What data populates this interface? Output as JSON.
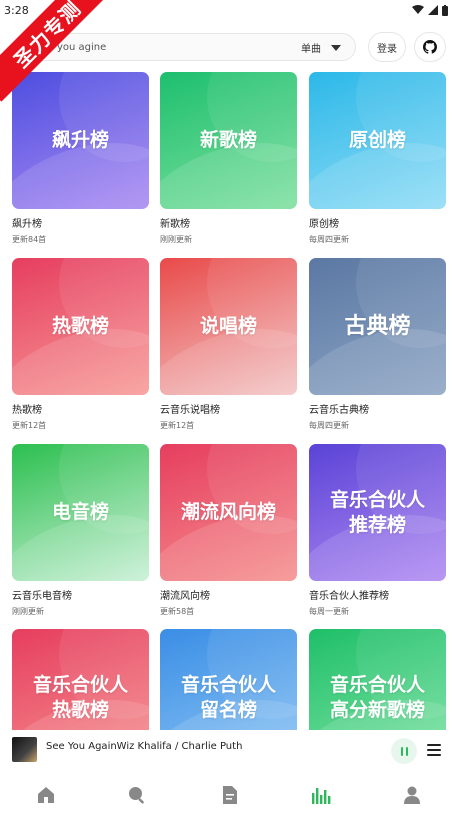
{
  "status": {
    "time": "3:28"
  },
  "ribbon": {
    "label": "圣力专测"
  },
  "search": {
    "value": "you agine",
    "type_label": "单曲"
  },
  "header": {
    "login_label": "登录"
  },
  "playlists": [
    {
      "cover_text": "飙升榜",
      "title": "飙升榜",
      "subtitle": "更新84首",
      "gradient": [
        "#4d4ee0",
        "#a98af2"
      ]
    },
    {
      "cover_text": "新歌榜",
      "title": "新歌榜",
      "subtitle": "刚刚更新",
      "gradient": [
        "#1dbf6e",
        "#7ee09f"
      ]
    },
    {
      "cover_text": "原创榜",
      "title": "原创榜",
      "subtitle": "每周四更新",
      "gradient": [
        "#2cb8e8",
        "#8fdcf6"
      ]
    },
    {
      "cover_text": "热歌榜",
      "title": "热歌榜",
      "subtitle": "更新12首",
      "gradient": [
        "#e63e5f",
        "#f79a97"
      ]
    },
    {
      "cover_text": "说唱榜",
      "title": "云音乐说唱榜",
      "subtitle": "更新12首",
      "gradient": [
        "#e94a4a",
        "#f3c6c6"
      ]
    },
    {
      "cover_text": "古典榜",
      "title": "云音乐古典榜",
      "subtitle": "每周四更新",
      "gradient": [
        "#5b78a3",
        "#8ba4c3"
      ]
    },
    {
      "cover_text": "电音榜",
      "title": "云音乐电音榜",
      "subtitle": "刚刚更新",
      "gradient": [
        "#2cbf4f",
        "#c8f0d5"
      ]
    },
    {
      "cover_text": "潮流风向榜",
      "title": "潮流风向榜",
      "subtitle": "更新58首",
      "gradient": [
        "#e63e5f",
        "#f58f8e"
      ]
    },
    {
      "cover_text": "音乐合伙人推荐榜",
      "title": "音乐合伙人推荐榜",
      "subtitle": "每周一更新",
      "gradient": [
        "#5a43d6",
        "#b08af2"
      ]
    },
    {
      "cover_text": "音乐合伙人热歌榜",
      "title": "",
      "subtitle": "",
      "gradient": [
        "#e63e5f",
        "#f5908e"
      ]
    },
    {
      "cover_text": "音乐合伙人留名榜",
      "title": "",
      "subtitle": "",
      "gradient": [
        "#3a8ee6",
        "#8cc4f3"
      ]
    },
    {
      "cover_text": "音乐合伙人高分新歌榜",
      "title": "",
      "subtitle": "",
      "gradient": [
        "#1fbf6a",
        "#7de3a2"
      ]
    }
  ],
  "player": {
    "song_text": "See You AgainWiz Khalifa / Charlie Puth"
  },
  "tabs": [
    {
      "icon": "home-icon",
      "active": false
    },
    {
      "icon": "search-icon",
      "active": false
    },
    {
      "icon": "document-icon",
      "active": false
    },
    {
      "icon": "chart-icon",
      "active": true
    },
    {
      "icon": "user-icon",
      "active": false
    }
  ],
  "colors": {
    "accent": "#2eb85c",
    "icon_inactive": "#888888",
    "ribbon": "#e8121f"
  }
}
